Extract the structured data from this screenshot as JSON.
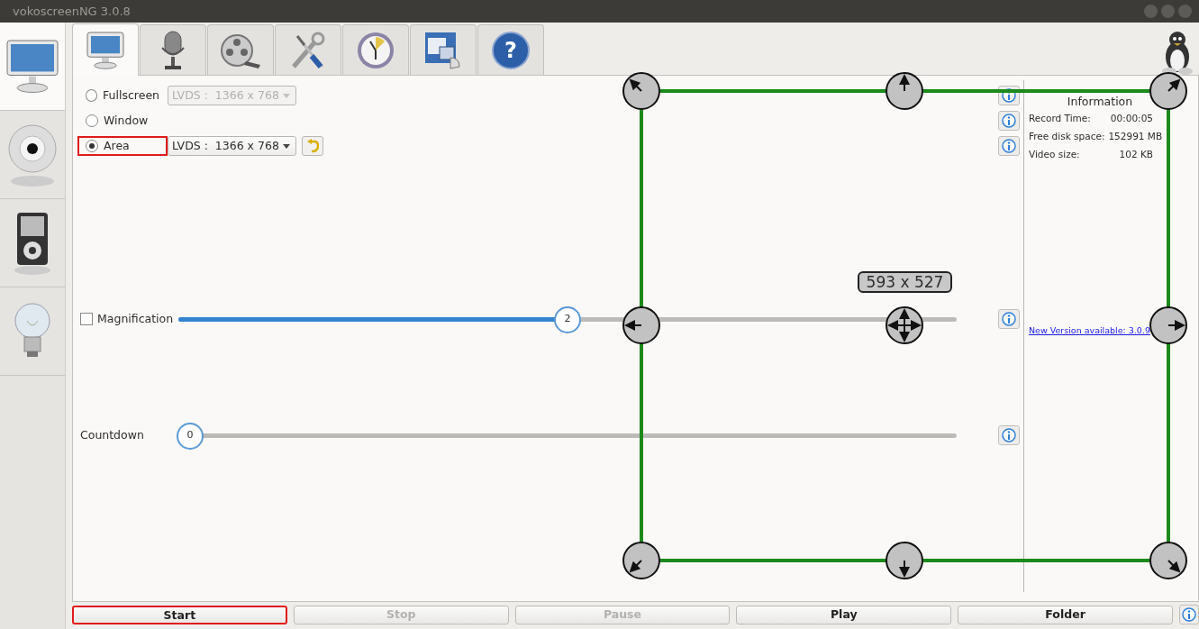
{
  "window": {
    "title": "vokoscreenNG 3.0.8"
  },
  "sidebar": {
    "items": [
      {
        "selected": true
      },
      {
        "selected": false
      },
      {
        "selected": false
      },
      {
        "selected": false
      }
    ]
  },
  "tabs": [
    {
      "selected": true
    },
    {
      "selected": false
    },
    {
      "selected": false
    },
    {
      "selected": false
    },
    {
      "selected": false
    },
    {
      "selected": false
    },
    {
      "selected": false,
      "symbol": "?"
    }
  ],
  "modes": [
    {
      "label": "Fullscreen",
      "selected": false,
      "highlighted": false,
      "screen": {
        "value": "LVDS :  1366 x 768",
        "disabled": true
      }
    },
    {
      "label": "Window",
      "selected": false,
      "highlighted": false
    },
    {
      "label": "Area",
      "selected": true,
      "highlighted": true,
      "screen": {
        "value": "LVDS :  1366 x 768",
        "disabled": false
      }
    }
  ],
  "magnification": {
    "label": "Magnification",
    "checked": false,
    "level": 0.5,
    "value": "2"
  },
  "countdown": {
    "label": "Countdown",
    "level": 0,
    "value": "0"
  },
  "information": {
    "title": "Information",
    "rows": [
      {
        "label": "Record Time:",
        "value": "00:00:05"
      },
      {
        "label": "Free disk space:",
        "value": "152991 MB"
      },
      {
        "label": "Video size:",
        "value": "102 KB"
      }
    ],
    "link": "New Version available: 3.0.9"
  },
  "buttons": [
    {
      "label": "Start",
      "disabled": false,
      "highlighted": true
    },
    {
      "label": "Stop",
      "disabled": true,
      "highlighted": false
    },
    {
      "label": "Pause",
      "disabled": true,
      "highlighted": false
    },
    {
      "label": "Play",
      "disabled": false,
      "highlighted": false
    },
    {
      "label": "Folder",
      "disabled": false,
      "highlighted": false
    }
  ],
  "area_overlay": {
    "size": "593 x 527"
  }
}
